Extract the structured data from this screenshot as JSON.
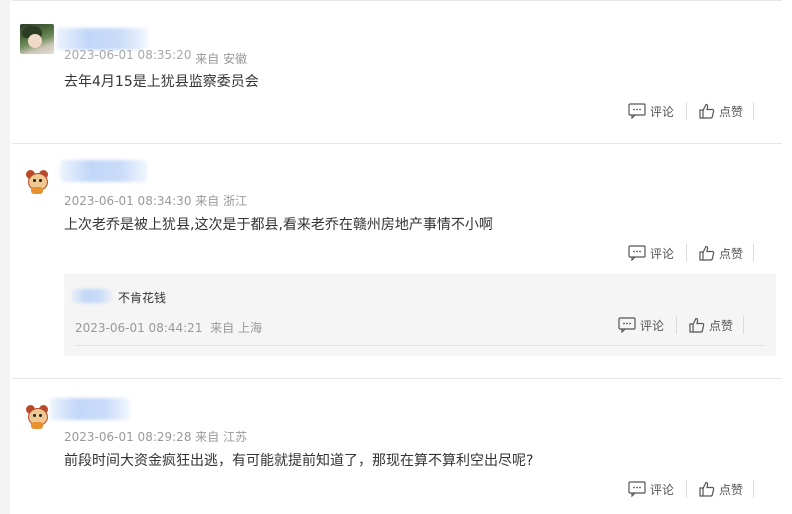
{
  "comments": [
    {
      "avatar": "anime-avatar",
      "meta_prefix": "2023-06-01 08:35:20",
      "meta_from": "来自",
      "meta_location": "安徽",
      "content": "去年4月15是上犹县监察委员会",
      "comment_label": "评论",
      "like_label": "点赞"
    },
    {
      "avatar": "bear-avatar",
      "meta_prefix": "2023-06-01 08:34:30",
      "meta_from": "来自",
      "meta_location": "浙江",
      "content": "上次老乔是被上犹县,这次是于都县,看来老乔在赣州房地产事情不小啊",
      "comment_label": "评论",
      "like_label": "点赞",
      "reply": {
        "name": "不肯花钱",
        "meta_prefix": "2023-06-01 08:44:21",
        "meta_from": "来自",
        "meta_location": "上海",
        "comment_label": "评论",
        "like_label": "点赞"
      }
    },
    {
      "avatar": "bear-avatar",
      "meta_prefix": "2023-06-01 08:29:28",
      "meta_from": "来自",
      "meta_location": "江苏",
      "content": "前段时间大资金疯狂出逃，有可能就提前知道了，那现在算不算利空出尽呢?",
      "comment_label": "评论",
      "like_label": "点赞"
    }
  ],
  "colors": {
    "meta": "#999999",
    "content": "#333333",
    "reply_bg": "#f5f5f5"
  }
}
